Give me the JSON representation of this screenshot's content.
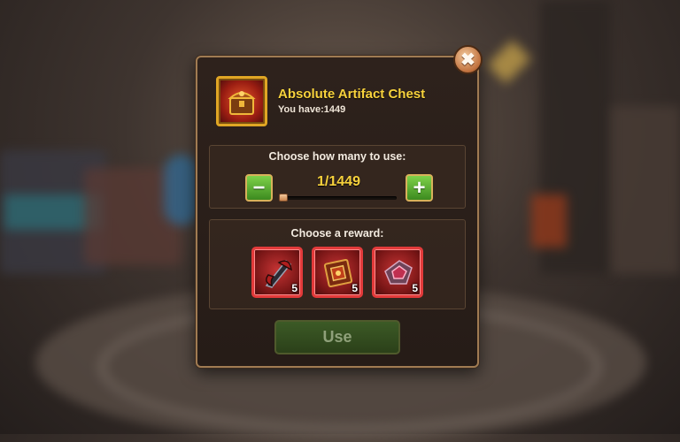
{
  "dialog": {
    "item_name": "Absolute Artifact Chest",
    "you_have": "You have:1449",
    "close_symbol": "✖",
    "quantity": {
      "label": "Choose how many to use:",
      "value": "1/1449",
      "selected": 1,
      "max": 1449,
      "minus_symbol": "−",
      "plus_symbol": "+"
    },
    "reward": {
      "label": "Choose a reward:",
      "options": [
        {
          "icon": "weapon-artifact-icon",
          "count": "5"
        },
        {
          "icon": "book-artifact-icon",
          "count": "5"
        },
        {
          "icon": "ring-artifact-icon",
          "count": "5"
        }
      ]
    },
    "use_label": "Use"
  },
  "colors": {
    "title": "#f7d23c",
    "frame_border": "#a07b52",
    "step_button": "#5fae35",
    "reward_border": "#e23a3a",
    "use_button_disabled": "#35501f"
  }
}
